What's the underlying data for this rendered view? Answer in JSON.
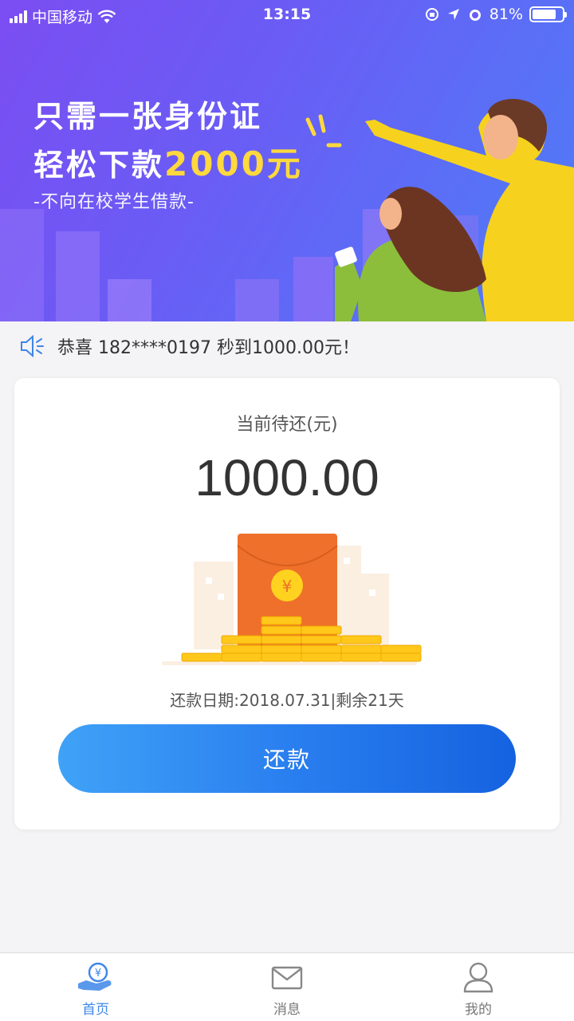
{
  "status_bar": {
    "carrier": "中国移动",
    "time": "13:15",
    "battery": "81%"
  },
  "banner": {
    "line1": "只需一张身份证",
    "line2_prefix": "轻松下款",
    "line2_amount": "2000元",
    "subtitle": "-不向在校学生借款-"
  },
  "notice": {
    "text": "恭喜 182****0197 秒到1000.00元！"
  },
  "card": {
    "label": "当前待还(元)",
    "amount": "1000.00",
    "due_info": "还款日期:2018.07.31|剩余21天",
    "repay_button": "还款"
  },
  "tabbar": {
    "items": [
      {
        "label": "首页",
        "icon": "home-coin-icon",
        "active": true
      },
      {
        "label": "消息",
        "icon": "mail-icon",
        "active": false
      },
      {
        "label": "我的",
        "icon": "user-icon",
        "active": false
      }
    ]
  },
  "colors": {
    "accent": "#3d86e8",
    "banner_start": "#7b4df2",
    "banner_end": "#4d7ef7",
    "highlight": "#ffd93d",
    "envelope": "#ee702a"
  }
}
